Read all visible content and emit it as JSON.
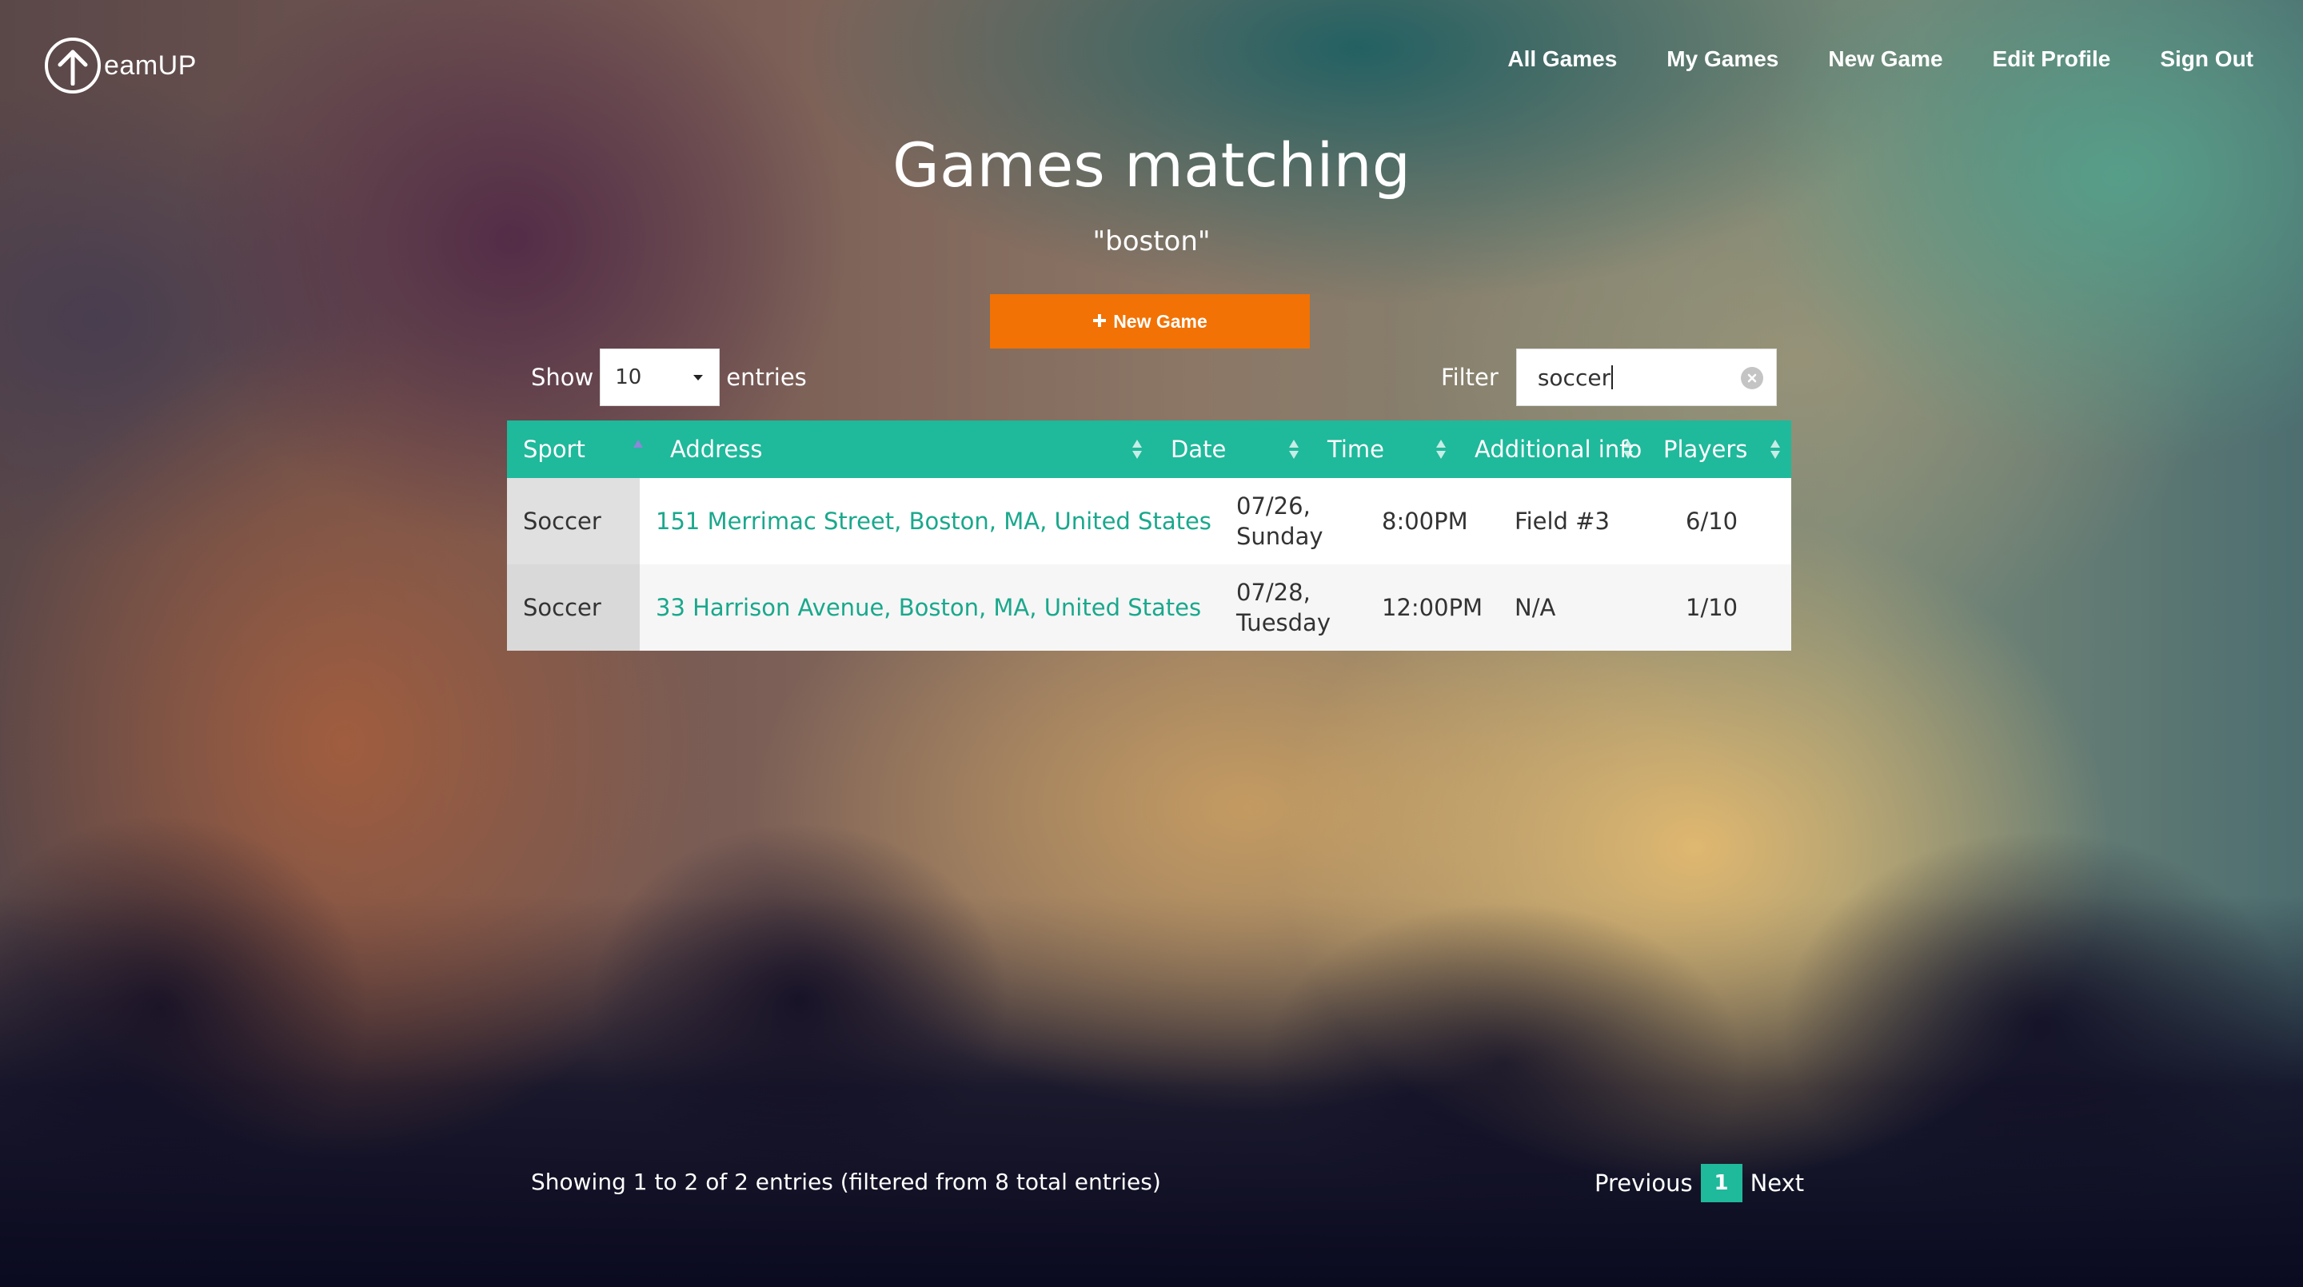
{
  "app": {
    "logo_text": "eamUP"
  },
  "nav": {
    "items": [
      "All Games",
      "My Games",
      "New Game",
      "Edit Profile",
      "Sign Out"
    ]
  },
  "header": {
    "title": "Games matching",
    "subtitle": "\"boston\""
  },
  "actions": {
    "new_game_label": "New Game"
  },
  "controls": {
    "show_label": "Show",
    "entries_value": "10",
    "entries_label": "entries",
    "filter_label": "Filter",
    "filter_value": "soccer"
  },
  "table": {
    "columns": [
      "Sport",
      "Address",
      "Date",
      "Time",
      "Additional info",
      "Players"
    ],
    "rows": [
      {
        "sport": "Soccer",
        "address": "151 Merrimac Street, Boston, MA, United States",
        "date_line1": "07/26,",
        "date_line2": "Sunday",
        "time": "8:00PM",
        "info": "Field #3",
        "players": "6/10"
      },
      {
        "sport": "Soccer",
        "address": "33 Harrison Avenue, Boston, MA, United States",
        "date_line1": "07/28,",
        "date_line2": "Tuesday",
        "time": "12:00PM",
        "info": "N/A",
        "players": "1/10"
      }
    ]
  },
  "footer": {
    "info_text": "Showing 1 to 2 of 2 entries (filtered from 8 total entries)",
    "previous_label": "Previous",
    "current_page": "1",
    "next_label": "Next"
  },
  "colors": {
    "accent": "#1fb99b",
    "button": "#f27205",
    "link": "#1aa88c"
  }
}
